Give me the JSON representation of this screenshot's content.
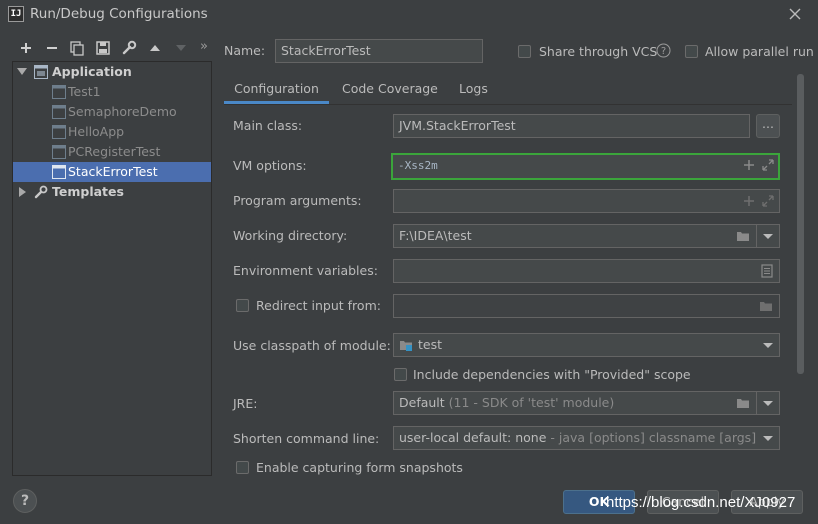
{
  "window": {
    "title": "Run/Debug Configurations",
    "logo_text": "IJ"
  },
  "toolbar": {
    "icons": [
      "add-icon",
      "remove-icon",
      "copy-icon",
      "save-icon",
      "wrench-icon",
      "move-up-icon",
      "move-down-icon",
      "more-icon"
    ],
    "more_label": "»"
  },
  "tree": {
    "application": {
      "label": "Application",
      "expanded": true
    },
    "items": [
      {
        "label": "Test1",
        "selected": false
      },
      {
        "label": "SemaphoreDemo",
        "selected": false
      },
      {
        "label": "HelloApp",
        "selected": false
      },
      {
        "label": "PCRegisterTest",
        "selected": false
      },
      {
        "label": "StackErrorTest",
        "selected": true
      }
    ],
    "templates": {
      "label": "Templates",
      "expanded": false
    }
  },
  "header": {
    "name_label": "Name:",
    "name_value": "StackErrorTest",
    "share_label": "Share through VCS",
    "share_checked": false,
    "parallel_label": "Allow parallel run",
    "parallel_checked": false
  },
  "tabs": [
    {
      "label": "Configuration",
      "active": true
    },
    {
      "label": "Code Coverage",
      "active": false
    },
    {
      "label": "Logs",
      "active": false
    }
  ],
  "form": {
    "main_class_label": "Main class:",
    "main_class_value": "JVM.StackErrorTest",
    "browse_label": "...",
    "vm_options_label": "VM options:",
    "vm_options_value": "-Xss2m",
    "program_args_label": "Program arguments:",
    "program_args_value": "",
    "working_dir_label": "Working directory:",
    "working_dir_value": "F:\\IDEA\\test",
    "env_vars_label": "Environment variables:",
    "env_vars_value": "",
    "redirect_label": "Redirect input from:",
    "redirect_checked": false,
    "redirect_value": "",
    "classpath_label": "Use classpath of module:",
    "classpath_value": "test",
    "include_deps_label": "Include dependencies with \"Provided\" scope",
    "include_deps_checked": false,
    "jre_label": "JRE:",
    "jre_value": "Default",
    "jre_hint": "(11 - SDK of 'test' module)",
    "shorten_label": "Shorten command line:",
    "shorten_value": "user-local default: none",
    "shorten_hint": "- java [options] classname [args]",
    "snapshots_label": "Enable capturing form snapshots",
    "snapshots_checked": false
  },
  "footer": {
    "help_label": "?",
    "ok_label": "OK",
    "cancel_label": "Cancel",
    "apply_label": "Apply"
  },
  "watermark": "https://blog.csdn.net/XJ0927",
  "colors": {
    "background": "#3c3f41",
    "selection": "#4b6eaf",
    "focus_border": "#3ba53b",
    "tab_underline": "#4a88c7",
    "ok_button": "#365880"
  }
}
